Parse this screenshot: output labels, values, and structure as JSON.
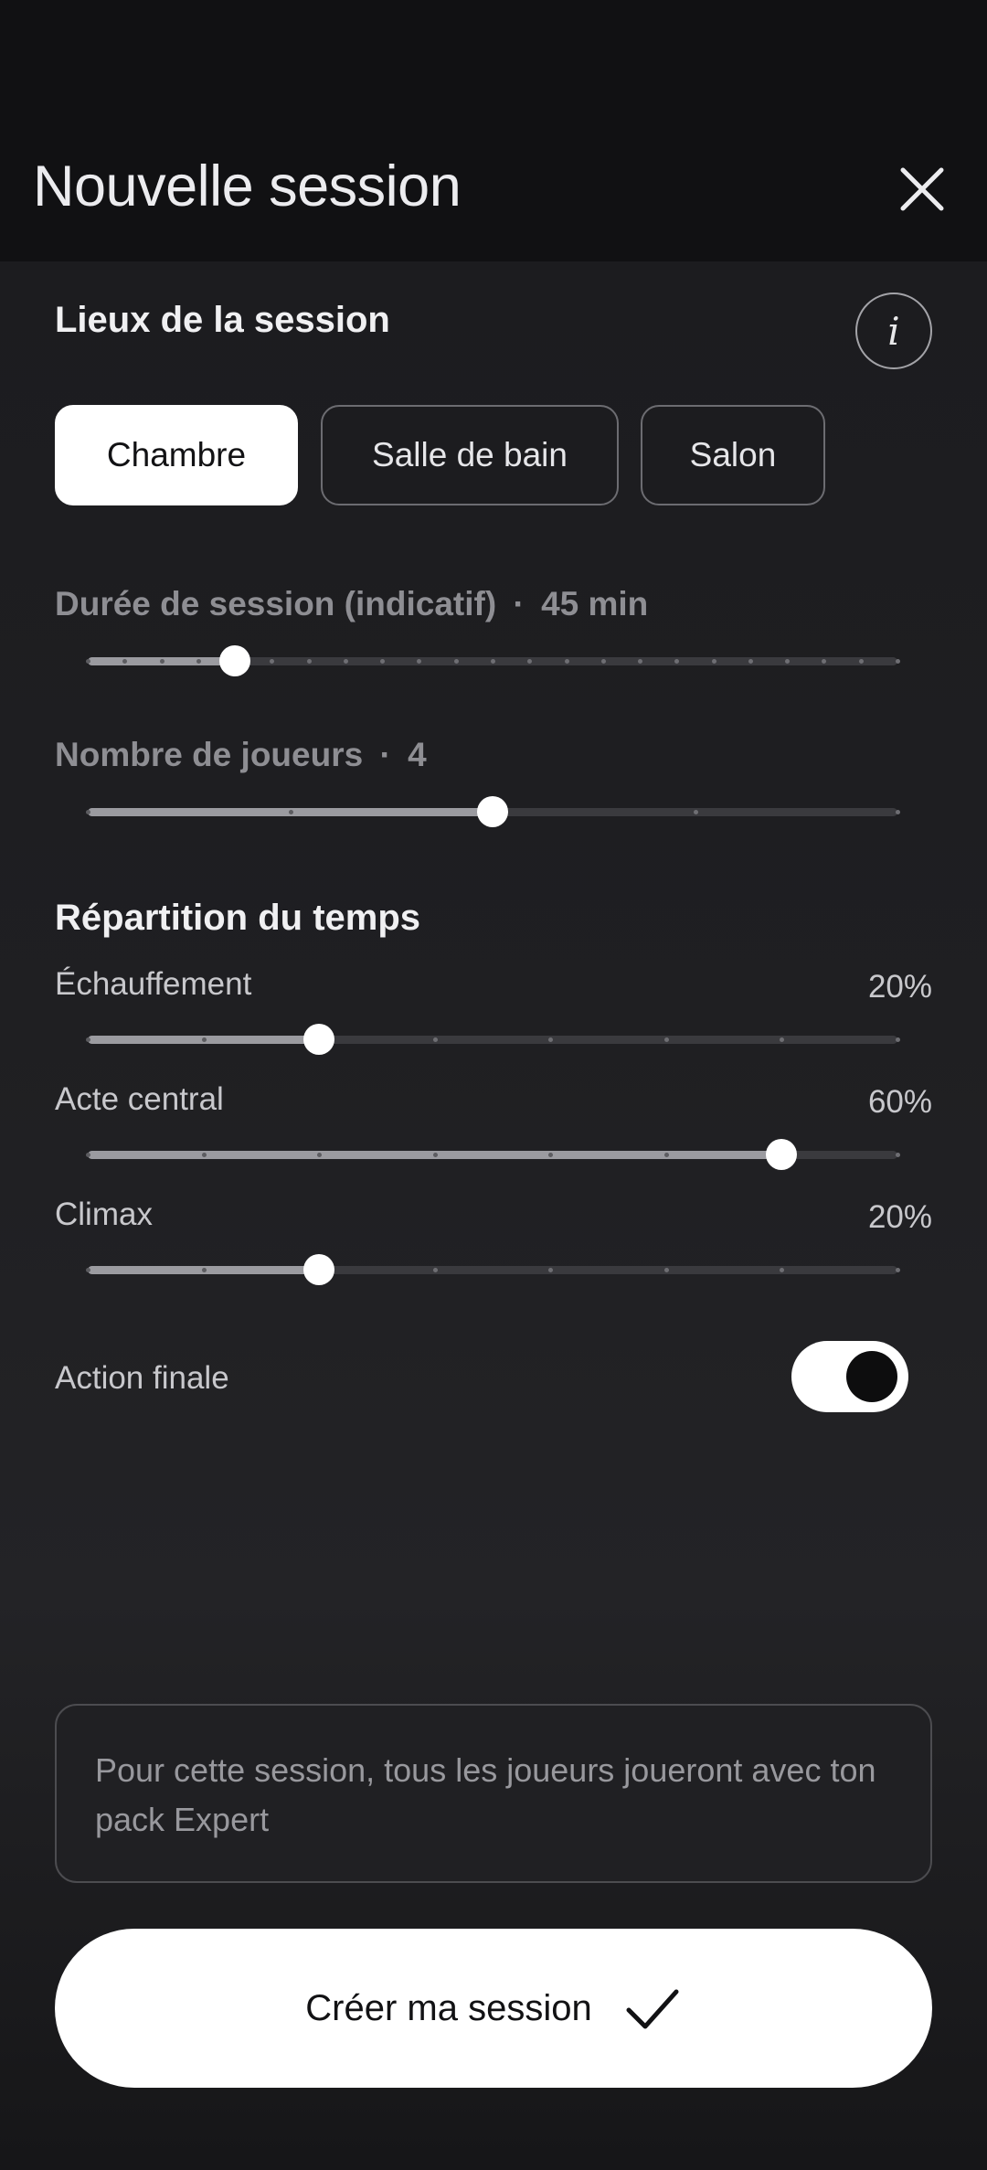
{
  "header": {
    "title": "Nouvelle session",
    "close_icon": "close-icon"
  },
  "location": {
    "title": "Lieux de la session",
    "info_icon": "info-icon",
    "info_glyph": "i",
    "chips": [
      {
        "label": "Chambre",
        "selected": true
      },
      {
        "label": "Salle de bain",
        "selected": false
      },
      {
        "label": "Salon",
        "selected": false
      }
    ]
  },
  "duration": {
    "label": "Durée de session (indicatif)",
    "separator": "·",
    "value": "45 min",
    "slider_value": 45,
    "slider_min": 15,
    "slider_max": 180,
    "slider_step": 7.5
  },
  "players": {
    "label": "Nombre de joueurs",
    "separator": "·",
    "value": "4",
    "slider_value": 4,
    "slider_min": 2,
    "slider_max": 6,
    "slider_step": 1
  },
  "time_split": {
    "title": "Répartition du temps",
    "items": [
      {
        "label": "Échauffement",
        "value_text": "20%",
        "value": 20
      },
      {
        "label": "Acte central",
        "value_text": "60%",
        "value": 60
      },
      {
        "label": "Climax",
        "value_text": "20%",
        "value": 20
      }
    ],
    "slider_min": 0,
    "slider_max": 70,
    "slider_step": 10
  },
  "final_action": {
    "label": "Action finale",
    "enabled": true
  },
  "note": {
    "text": "Pour cette session, tous les joueurs joueront avec ton pack Expert"
  },
  "cta": {
    "label": "Créer ma session",
    "icon": "check-icon"
  },
  "colors": {
    "background": "#131315",
    "accent": "#ffffff",
    "slider_fill": "#9b9ba0",
    "slider_track": "#3a3a3e"
  }
}
